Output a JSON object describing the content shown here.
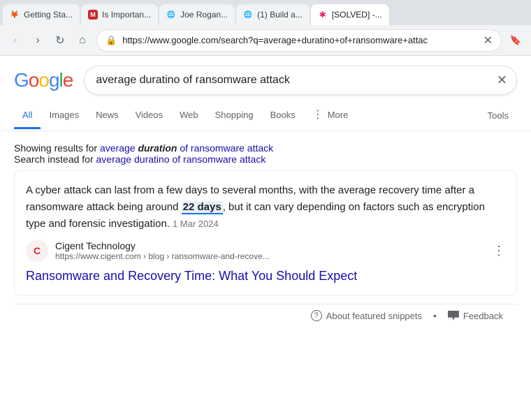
{
  "browser": {
    "url": "https://www.google.com/search?q=average+duratino+of+ransomware+attac",
    "tabs": [
      {
        "id": "tab-1",
        "title": "Getting Sta...",
        "favicon": "🦊",
        "active": false
      },
      {
        "id": "tab-2",
        "title": "Is Importan...",
        "favicon": "M",
        "active": false
      },
      {
        "id": "tab-3",
        "title": "Joe Rogan...",
        "favicon": "🌐",
        "active": false
      },
      {
        "id": "tab-4",
        "title": "(1) Build a...",
        "favicon": "🌐",
        "active": false
      },
      {
        "id": "tab-5",
        "title": "[SOLVED] -...",
        "favicon": "✱",
        "active": true
      }
    ]
  },
  "google": {
    "logo_letters": [
      "G",
      "o",
      "o",
      "g",
      "l",
      "e"
    ],
    "search_query": "average duratino of ransomware attack",
    "tabs": [
      {
        "id": "all",
        "label": "All",
        "active": true
      },
      {
        "id": "images",
        "label": "Images",
        "active": false
      },
      {
        "id": "news",
        "label": "News",
        "active": false
      },
      {
        "id": "videos",
        "label": "Videos",
        "active": false
      },
      {
        "id": "web",
        "label": "Web",
        "active": false
      },
      {
        "id": "shopping",
        "label": "Shopping",
        "active": false
      },
      {
        "id": "books",
        "label": "Books",
        "active": false
      },
      {
        "id": "more",
        "label": "More",
        "active": false
      }
    ],
    "tools_label": "Tools",
    "spell_check": {
      "showing_prefix": "Showing results for ",
      "corrected_pre": "average ",
      "corrected_bold": "duration",
      "corrected_post": " of ransomware attack",
      "instead_prefix": "Search instead for ",
      "instead_link": "average duratino of ransomware attack"
    },
    "snippet": {
      "text_pre": "A cyber attack can last from a few days to several months, with the average recovery time after a ransomware attack being around ",
      "highlight": "22 days",
      "text_post": ", but it can vary depending on factors such as encryption type and forensic investigation.",
      "date": "1 Mar 2024",
      "source_name": "Cigent Technology",
      "source_url": "https://www.cigent.com › blog › ransomware-and-recove...",
      "source_favicon_letter": "C",
      "result_link": "Ransomware and Recovery Time: What You Should Expect"
    },
    "footer": {
      "about_label": "About featured snippets",
      "feedback_label": "Feedback"
    }
  },
  "icons": {
    "back": "‹",
    "forward": "›",
    "reload": "↻",
    "home": "⌂",
    "bookmark": "🔖",
    "lock": "🔒",
    "clear": "✕",
    "question": "?",
    "flag": "⚑",
    "dots": "⋮"
  }
}
